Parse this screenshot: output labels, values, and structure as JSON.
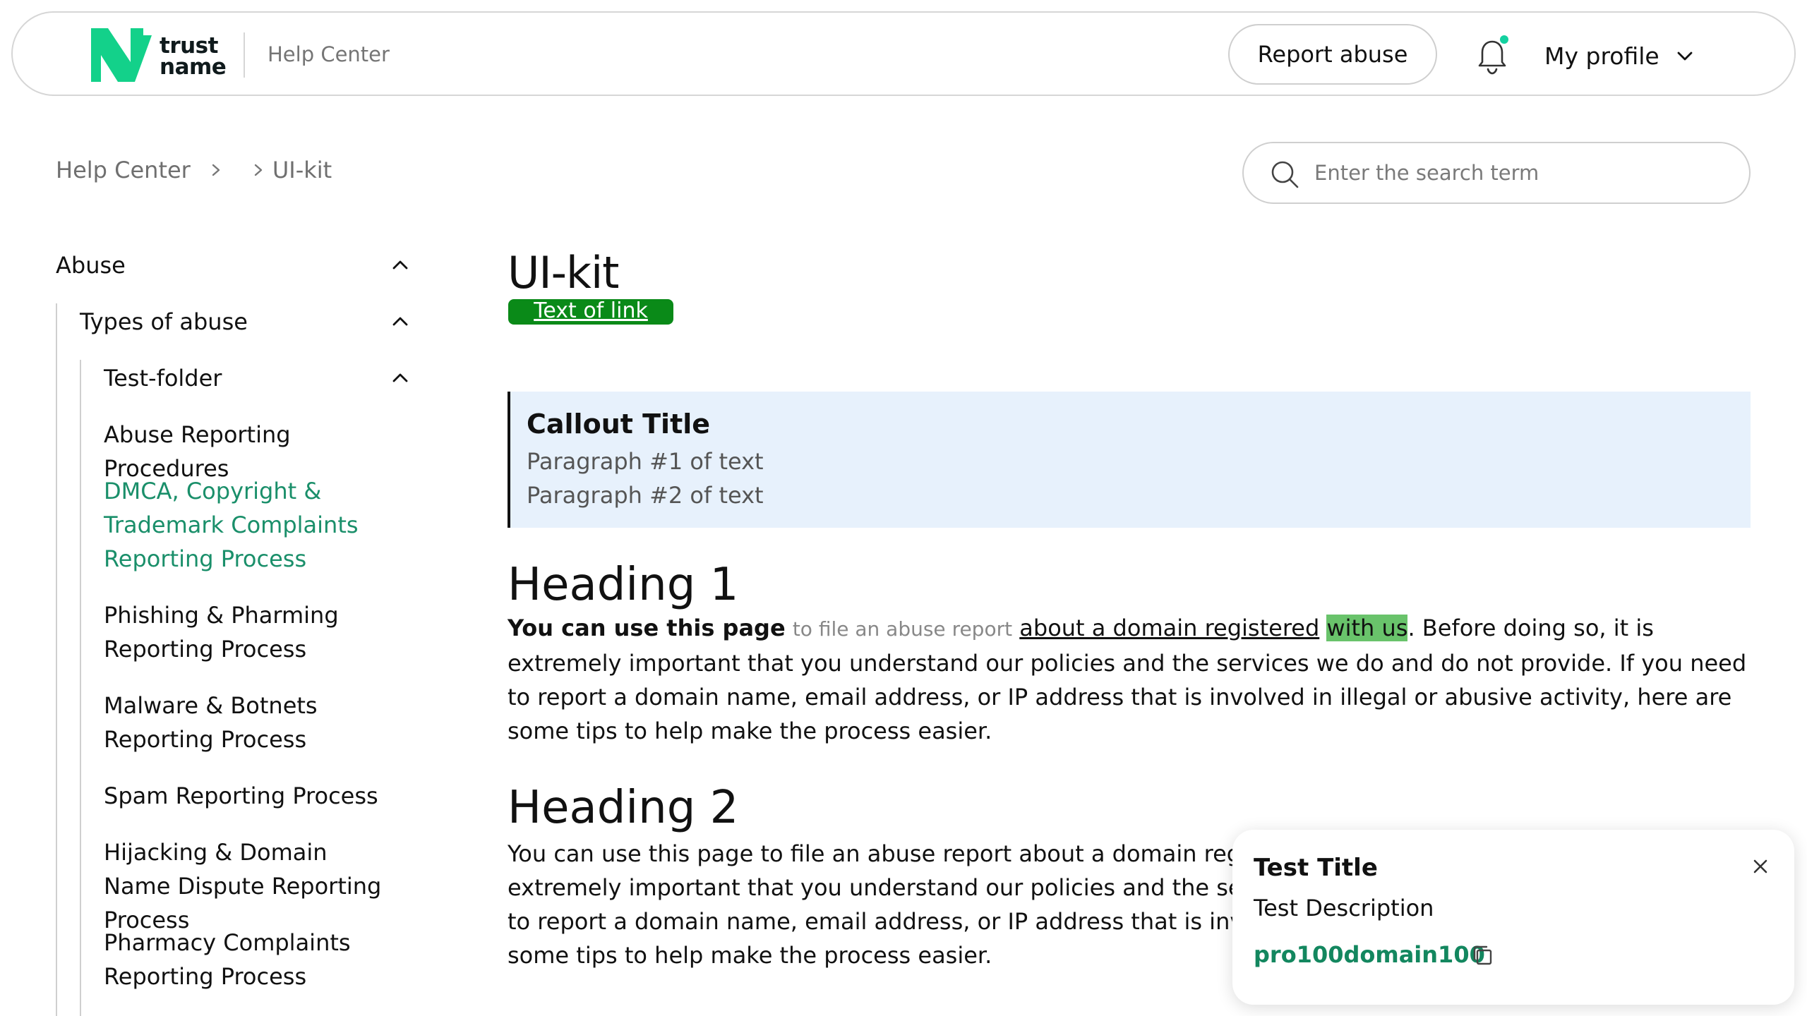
{
  "header": {
    "logo_line1": "trust",
    "logo_line2": "name",
    "section_title": "Help Center",
    "report_abuse_label": "Report abuse",
    "profile_label": "My profile"
  },
  "breadcrumb": {
    "items": [
      "Help Center",
      "UI-kit"
    ]
  },
  "search": {
    "placeholder": "Enter the search term"
  },
  "sidebar": {
    "level1": "Abuse",
    "level2": "Types of abuse",
    "level3": "Test-folder",
    "items": [
      "Abuse Reporting Procedures",
      "DMCA, Copyright & Trademark Complaints Reporting Process",
      "Phishing & Pharming Reporting Process",
      "Malware & Botnets Reporting Process",
      "Spam Reporting Process",
      "Hijacking & Domain Name Dispute Reporting Process",
      "Pharmacy Complaints Reporting Process"
    ]
  },
  "main": {
    "title": "UI-kit",
    "link_text": "Text of link",
    "callout": {
      "title": "Callout Title",
      "p1": "Paragraph #1 of text",
      "p2": "Paragraph #2 of text"
    },
    "heading1": "Heading 1",
    "para1": {
      "bold": "You can use this page",
      "small": "to file an abuse report",
      "link": "about a domain registered",
      "highlight": "with us",
      "rest": ". Before doing so, it is extremely important that you understand our policies and the services we do and do not provide. If you need to report a domain name, email address, or IP address that is involved in illegal or abusive activity, here are some tips to help make the process easier."
    },
    "heading2": "Heading 2",
    "para2": "You can use this page to file an abuse report about a domain registered with us. Before doing so, it is extremely important that you understand our policies and the services we do and do not provide. If you need to report a domain name, email address, or IP address that is involved in illegal or abusive activity, here are some tips to help make the process easier."
  },
  "toast": {
    "title": "Test Title",
    "description": "Test Description",
    "code": "pro100domain100"
  },
  "colors": {
    "brand_green": "#13d18a",
    "active_link": "#1a8f6a",
    "link_badge_bg": "#0a8a18",
    "callout_bg": "#e7f1fc",
    "highlight": "#69c36b",
    "notification_dot": "#13d1a0"
  },
  "icons": [
    "bell-icon",
    "chevron-down-icon",
    "chevron-right-icon",
    "chevron-up-icon",
    "search-icon",
    "close-icon",
    "copy-icon"
  ]
}
